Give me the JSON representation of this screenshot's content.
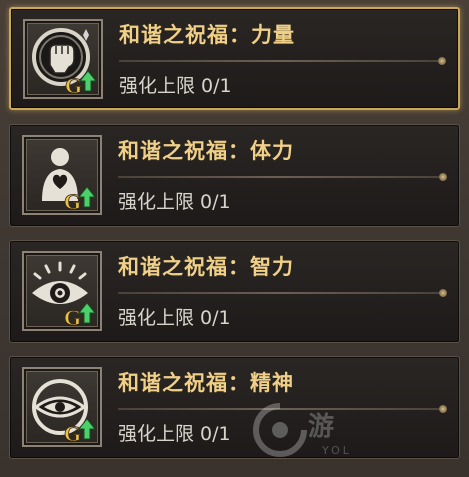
{
  "blessings": [
    {
      "title": "和谐之祝福：力量",
      "limit": "强化上限 0/1",
      "icon": "fist-icon",
      "selected": true
    },
    {
      "title": "和谐之祝福：体力",
      "limit": "强化上限 0/1",
      "icon": "heart-body-icon",
      "selected": false
    },
    {
      "title": "和谐之祝福：智力",
      "limit": "强化上限 0/1",
      "icon": "radiant-eye-icon",
      "selected": false
    },
    {
      "title": "和谐之祝福：精神",
      "limit": "强化上限 0/1",
      "icon": "ringed-eye-icon",
      "selected": false
    }
  ],
  "badge": {
    "letter": "G",
    "upgrade_icon": "arrow-up-icon",
    "letter_color": "#e8c24a",
    "arrow_color": "#4bd16a"
  },
  "colors": {
    "title": "#f0cf86",
    "limit_text": "#d8d4cc",
    "selected_border": "#c9a85a"
  },
  "watermark": {
    "text": "游",
    "sub": "YOL"
  }
}
